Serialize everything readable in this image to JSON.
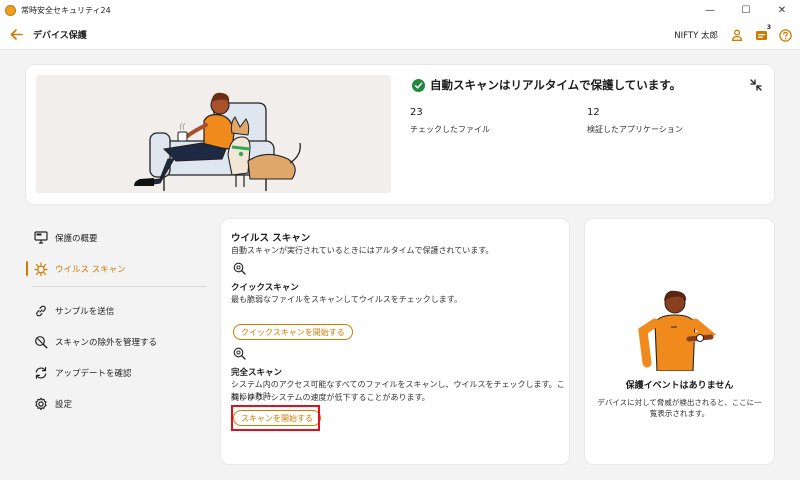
{
  "window": {
    "title": "常時安全セキュリティ24",
    "minimize": "—",
    "maximize": "☐",
    "close": "✕"
  },
  "header": {
    "title": "デバイス保護",
    "user_name": "NIFTY 太郎",
    "notification_count": "3"
  },
  "hero": {
    "status": "自動スキャンはリアルタイムで保護しています。",
    "stats": [
      {
        "value": "23",
        "label": "チェックしたファイル"
      },
      {
        "value": "12",
        "label": "検証したアプリケーション"
      }
    ]
  },
  "nav": {
    "items": [
      {
        "label": "保護の概要",
        "icon": "monitor-icon"
      },
      {
        "label": "ウイルス スキャン",
        "icon": "virus-icon",
        "active": true
      },
      {
        "label": "サンプルを送信",
        "icon": "link-icon"
      },
      {
        "label": "スキャンの除外を管理する",
        "icon": "exclusion-icon"
      },
      {
        "label": "アップデートを確認",
        "icon": "refresh-icon"
      },
      {
        "label": "設定",
        "icon": "gear-icon"
      }
    ]
  },
  "virus_scan": {
    "title": "ウイルス スキャン",
    "subtitle": "自動スキャンが実行されているときにはアルタイムで保護されています。",
    "quick": {
      "title": "クイックスキャン",
      "description": "最も脆弱なファイルをスキャンしてウイルスをチェックします。",
      "button": "クイックスキャンを開始する"
    },
    "full": {
      "title": "完全スキャン",
      "description_line1": "システム内のアクセス可能なすべてのファイルをスキャンし、ウイルスをチェックします。これには数時",
      "description_line2": "間かかり、システムの速度が低下することがあります。",
      "button": "スキャンを開始する"
    }
  },
  "events": {
    "title": "保護イベントはありません",
    "description": "デバイスに対して脅威が検出されると、ここに一覧表示されます。"
  },
  "colors": {
    "accent": "#d27a00",
    "success": "#1f8a3f",
    "highlight": "#e01020"
  }
}
